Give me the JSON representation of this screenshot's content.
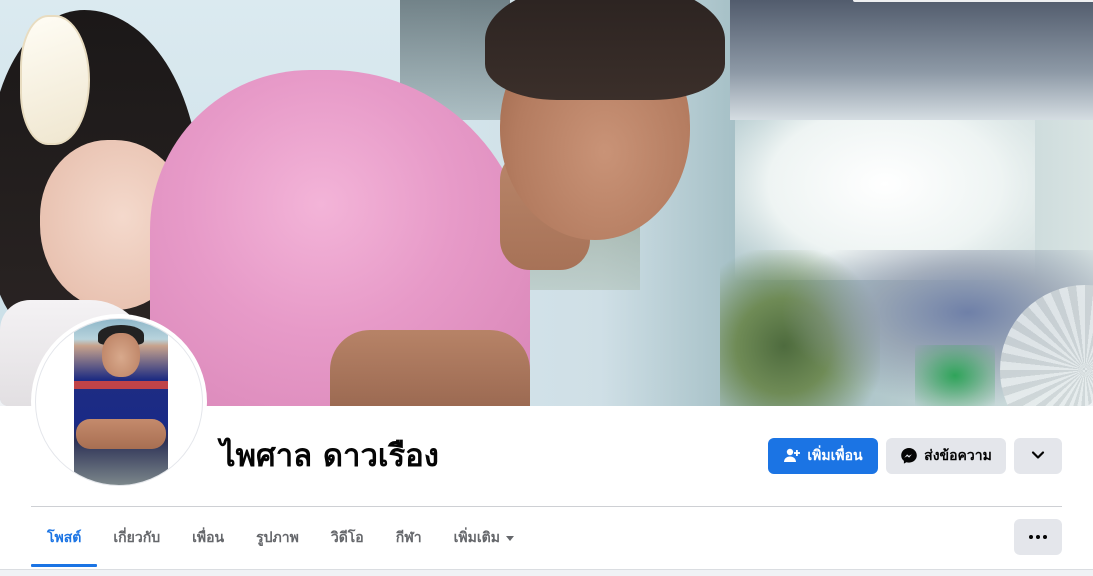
{
  "profile": {
    "name": "ไพศาล ดาวเรือง"
  },
  "actions": {
    "add_friend_label": "เพิ่มเพื่อน",
    "message_label": "ส่งข้อความ"
  },
  "tabs": [
    {
      "label": "โพสต์",
      "active": true
    },
    {
      "label": "เกี่ยวกับ",
      "active": false
    },
    {
      "label": "เพื่อน",
      "active": false
    },
    {
      "label": "รูปภาพ",
      "active": false
    },
    {
      "label": "วิดีโอ",
      "active": false
    },
    {
      "label": "กีฬา",
      "active": false
    },
    {
      "label": "เพิ่มเติม",
      "active": false
    }
  ],
  "icons": {
    "add_friend": "person-plus-icon",
    "message": "messenger-icon",
    "more_actions": "chevron-down-icon",
    "tabs_more": "more-dots-icon",
    "tab_more_caret": "caret-down-icon"
  },
  "colors": {
    "accent": "#1b74e4",
    "secondary_button": "#e4e6eb",
    "text_primary": "#050505",
    "text_secondary": "#65676b",
    "page_background": "#f0f2f5"
  }
}
